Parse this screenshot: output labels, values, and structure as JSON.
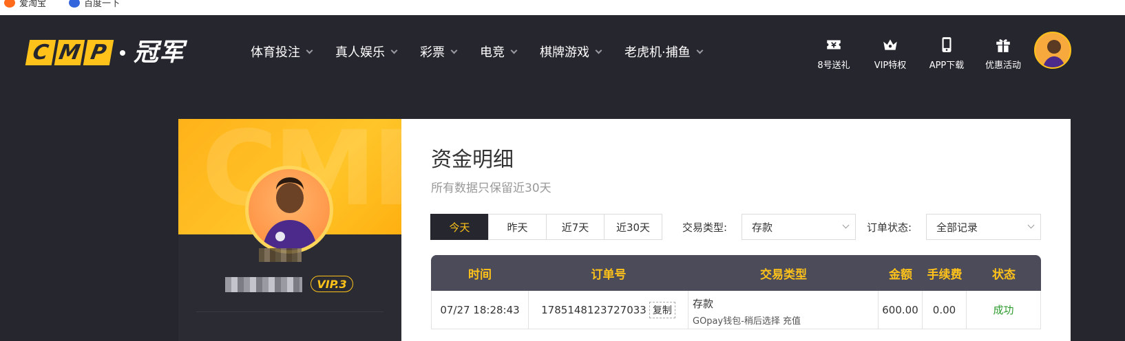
{
  "bookmarks": [
    {
      "label": "爱淘宝",
      "color": "#ff6a1a"
    },
    {
      "label": "百度一下",
      "color": "#3366dd"
    }
  ],
  "header": {
    "logo_letters": [
      "C",
      "M",
      "P"
    ],
    "logo_cn": "冠军",
    "nav": [
      {
        "label": "体育投注"
      },
      {
        "label": "真人娱乐"
      },
      {
        "label": "彩票"
      },
      {
        "label": "电竞"
      },
      {
        "label": "棋牌游戏"
      },
      {
        "label": "老虎机·捕鱼"
      }
    ],
    "tools": [
      {
        "label": "8号送礼",
        "icon": "ticket-icon"
      },
      {
        "label": "VIP特权",
        "icon": "crown-icon"
      },
      {
        "label": "APP下载",
        "icon": "phone-icon"
      },
      {
        "label": "优惠活动",
        "icon": "gift-icon"
      }
    ]
  },
  "profile": {
    "watermark": "CMP",
    "vip": "VIP.3"
  },
  "main": {
    "title": "资金明细",
    "subtitle": "所有数据只保留近30天",
    "ranges": [
      "今天",
      "昨天",
      "近7天",
      "近30天"
    ],
    "active_range": "今天",
    "type_filter": {
      "label": "交易类型:",
      "value": "存款"
    },
    "status_filter": {
      "label": "订单状态:",
      "value": "全部记录"
    },
    "columns": [
      "时间",
      "订单号",
      "交易类型",
      "金额",
      "手续费",
      "状态"
    ],
    "rows": [
      {
        "time": "07/27 18:28:43",
        "order": "1785148123727033",
        "copy_label": "复制",
        "type_main": "存款",
        "type_sub": "GOpay钱包-稍后选择 充值",
        "amount": "600.00",
        "fee": "0.00",
        "status": "成功"
      }
    ]
  },
  "colors": {
    "accent": "#ffc21a",
    "header_bg": "#25262e",
    "table_head": "#4b4b5a",
    "success": "#2c9a2c"
  }
}
